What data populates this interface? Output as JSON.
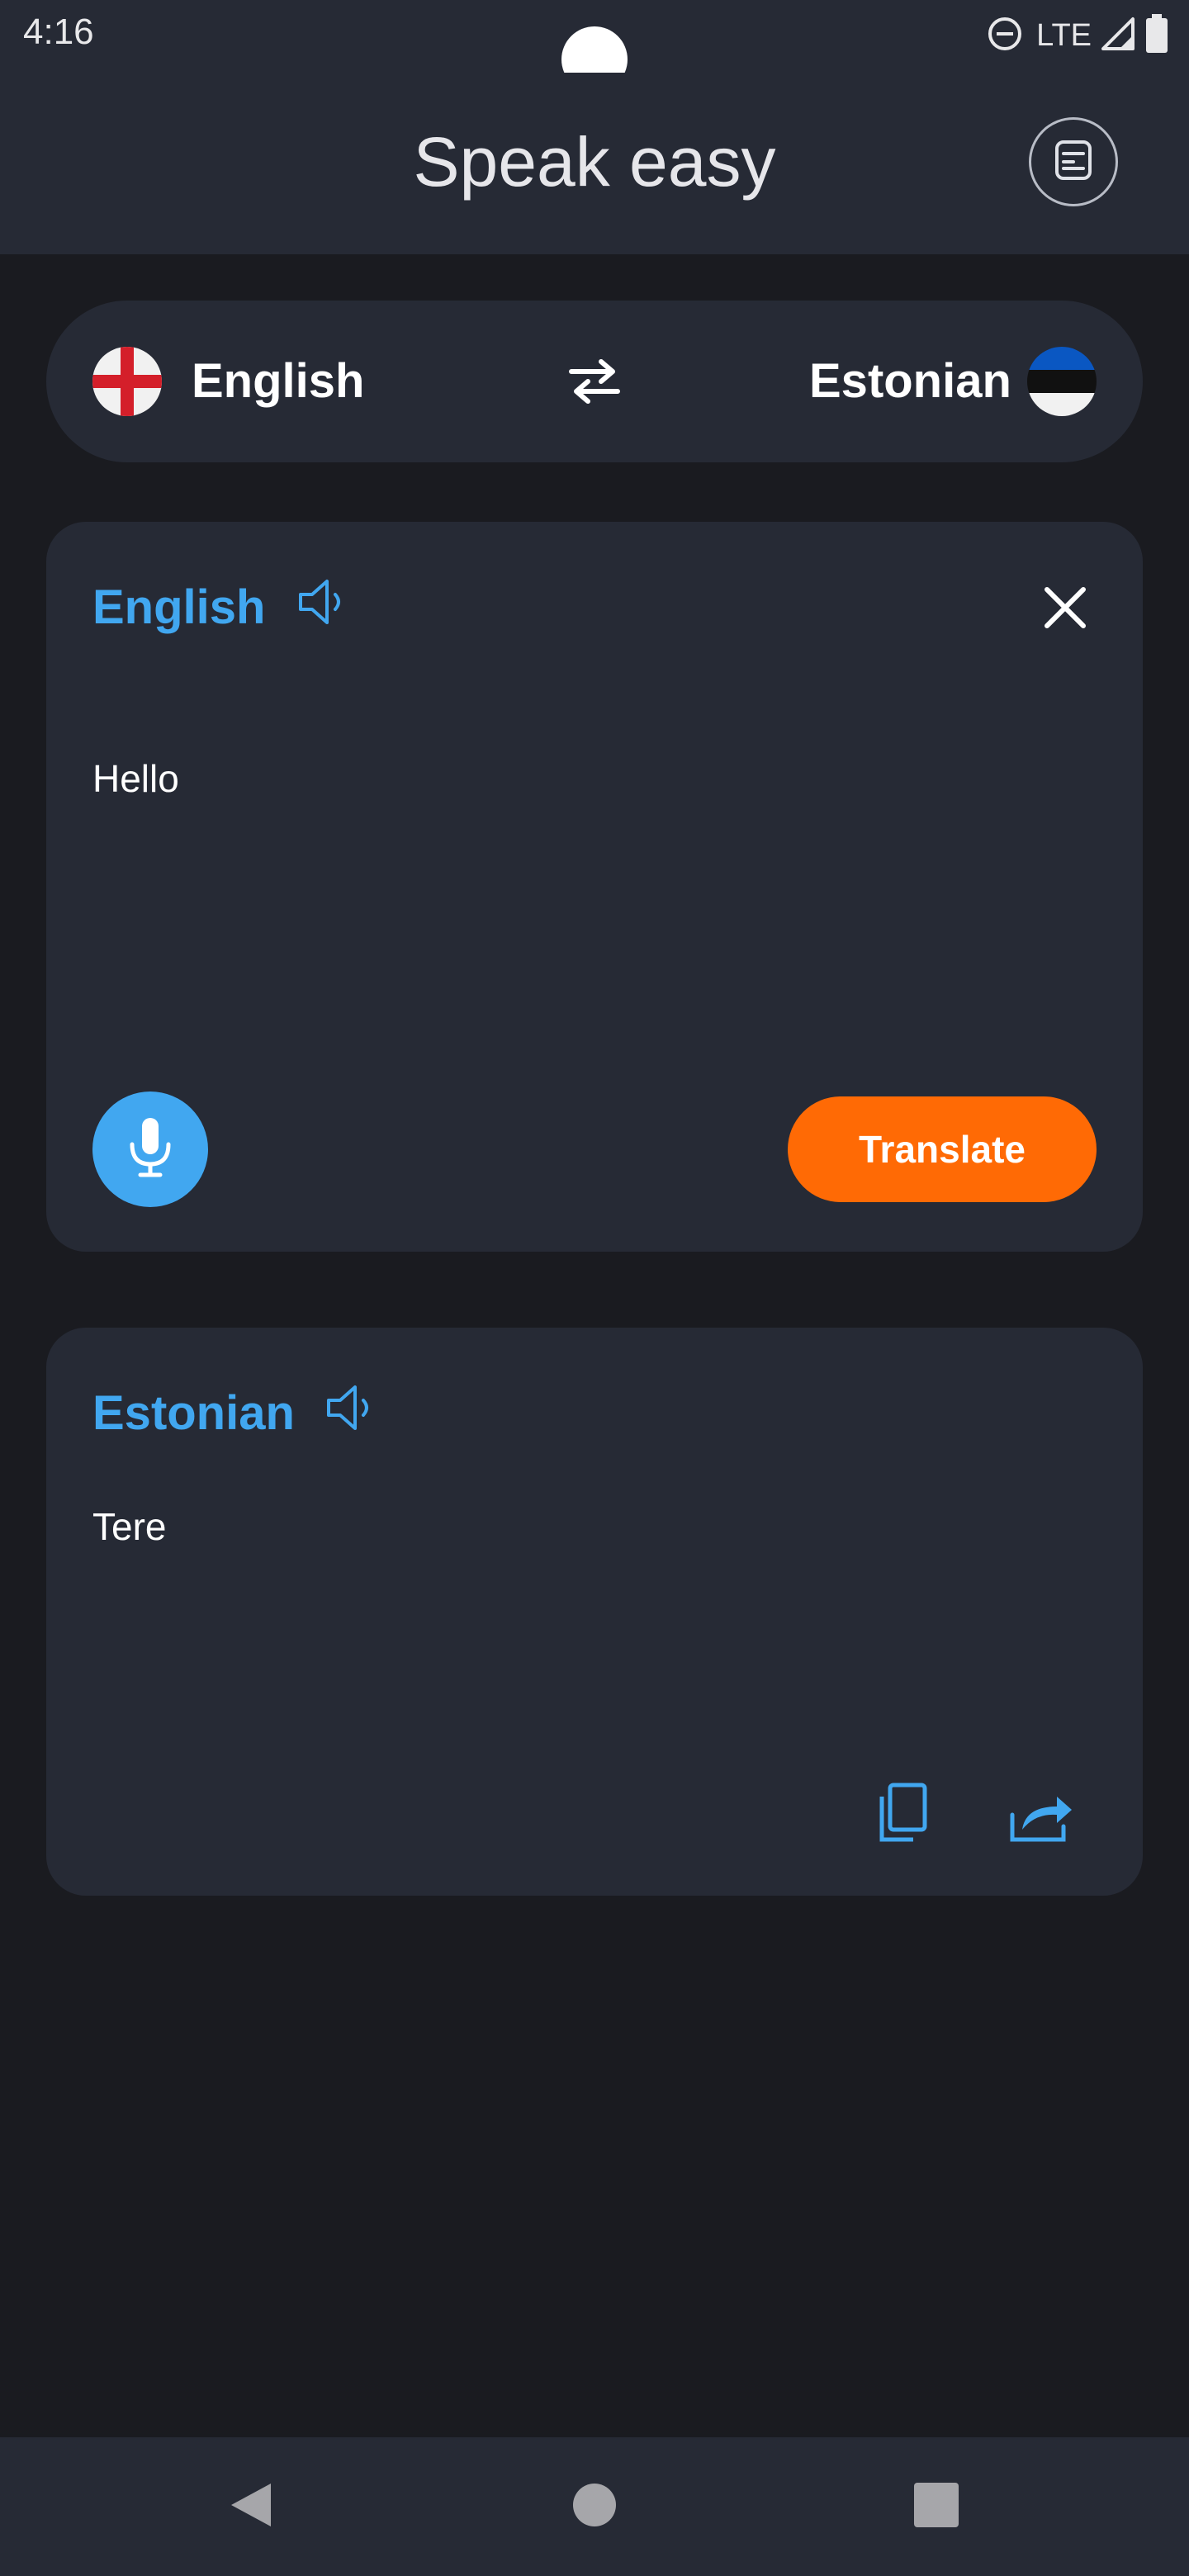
{
  "status_bar": {
    "time": "4:16",
    "network": "LTE",
    "icons": [
      "do-not-disturb-icon",
      "signal-icon",
      "battery-icon"
    ]
  },
  "header": {
    "title": "Speak easy",
    "history_icon": "history-icon"
  },
  "language_selector": {
    "source_language": "English",
    "target_language": "Estonian",
    "swap_icon": "swap-icon",
    "source_flag": "england-flag",
    "target_flag": "estonia-flag"
  },
  "input_card": {
    "language": "English",
    "text": "Hello",
    "speaker_icon": "speaker-icon",
    "close_icon": "close-icon",
    "mic_icon": "microphone-icon",
    "translate_label": "Translate"
  },
  "output_card": {
    "language": "Estonian",
    "text": "Tere",
    "speaker_icon": "speaker-icon",
    "copy_icon": "copy-icon",
    "share_icon": "share-icon"
  },
  "nav_bar": {
    "items": [
      "back-icon",
      "home-icon",
      "recents-icon"
    ]
  },
  "colors": {
    "background": "#1a1b20",
    "surface": "#262a35",
    "accent_blue": "#41a7f0",
    "accent_orange": "#ff6a05",
    "text_primary": "#ffffff"
  }
}
